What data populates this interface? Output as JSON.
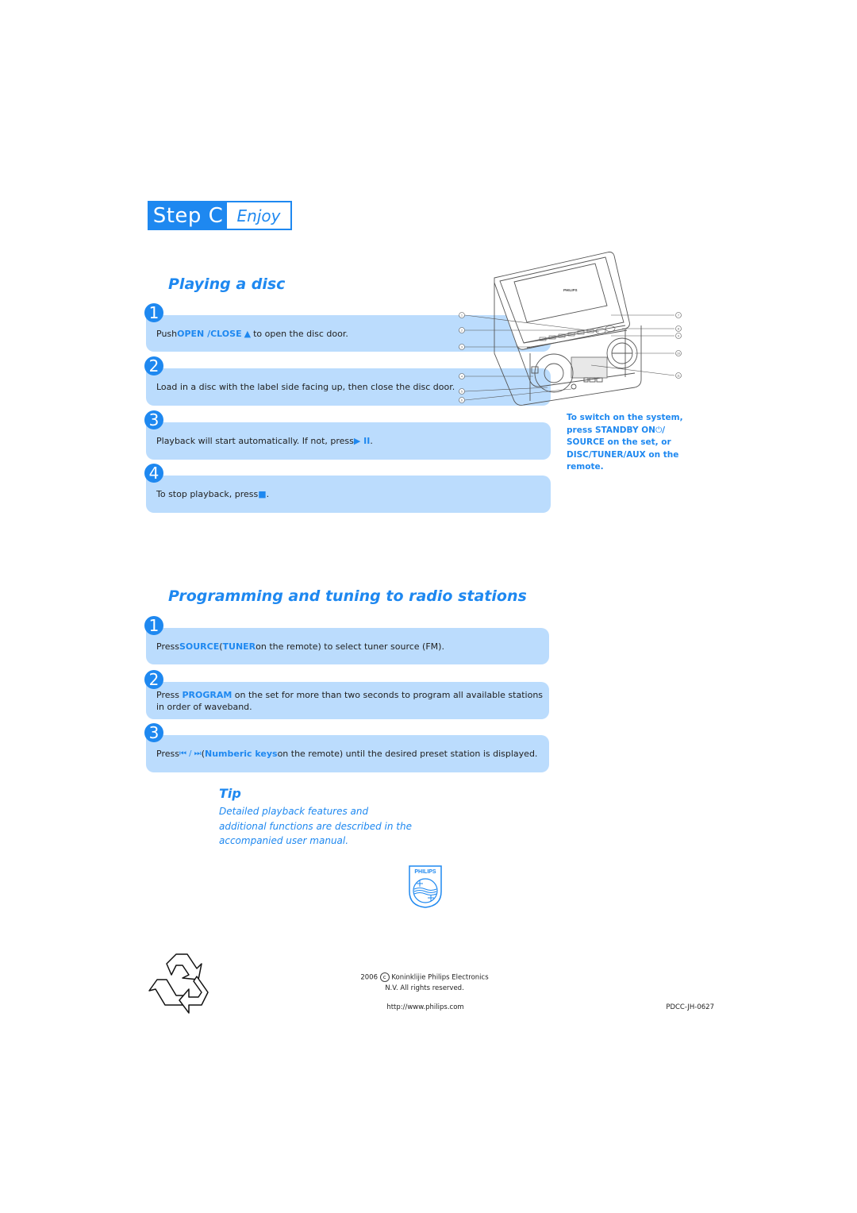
{
  "header": {
    "step_label": "Step C",
    "step_title": "Enjoy"
  },
  "playing_disc": {
    "title": "Playing a disc",
    "steps": [
      {
        "num": "1",
        "parts": [
          "Push ",
          "OPEN /CLOSE",
          "▲",
          " to open the disc door."
        ]
      },
      {
        "num": "2",
        "text": "Load in a disc with the label side facing up, then close the disc door."
      },
      {
        "num": "3",
        "parts": [
          "Playback will start automatically. If not, press ",
          "▶ II",
          "."
        ]
      },
      {
        "num": "4",
        "parts": [
          "To stop playback, press ",
          "■",
          "."
        ]
      }
    ],
    "device_callouts": [
      "1",
      "2",
      "3",
      "4",
      "5",
      "6",
      "7",
      "8",
      "9",
      "10",
      "11"
    ],
    "device_brand": "PHILIPS",
    "side_note": {
      "line1": "To switch on the system,",
      "line2_a": "press ",
      "line2_b": "STANDBY ON",
      "line2_icon": "⏻",
      "line2_c": "/",
      "line3_a": "SOURCE",
      "line3_b": " on the set, or",
      "line4_a": "DISC/TUNER/AUX",
      "line4_b": " on the",
      "line5": "remote."
    }
  },
  "radio": {
    "title": "Programming and tuning to radio stations",
    "steps": [
      {
        "num": "1",
        "parts": [
          "Press ",
          "SOURCE",
          " (",
          "TUNER",
          " on the remote) to select tuner source (FM)."
        ]
      },
      {
        "num": "2",
        "parts": [
          "Press ",
          "PROGRAM",
          " on the set for more than two seconds to program all available stations",
          "in order of waveband."
        ]
      },
      {
        "num": "3",
        "parts": [
          "Press ",
          "⏮ / ⏭",
          " (",
          "Numberic keys",
          " on the remote) until the desired preset station is displayed."
        ]
      }
    ]
  },
  "tip": {
    "title": "Tip",
    "lines": [
      "Detailed playback features and",
      "additional functions are described in the",
      "accompanied user manual."
    ]
  },
  "logo": {
    "brand": "PHILIPS"
  },
  "footer": {
    "copyright_year": "2006",
    "copyright_symbol": "c",
    "copyright_line1": "Koninklijie Philips Electronics",
    "copyright_line2": "N.V. All rights reserved.",
    "url": "http://www.philips.com",
    "doc_code": "PDCC-JH-0627"
  },
  "colors": {
    "accent": "#1e88f0",
    "box_bg": "#bbdcfd"
  }
}
